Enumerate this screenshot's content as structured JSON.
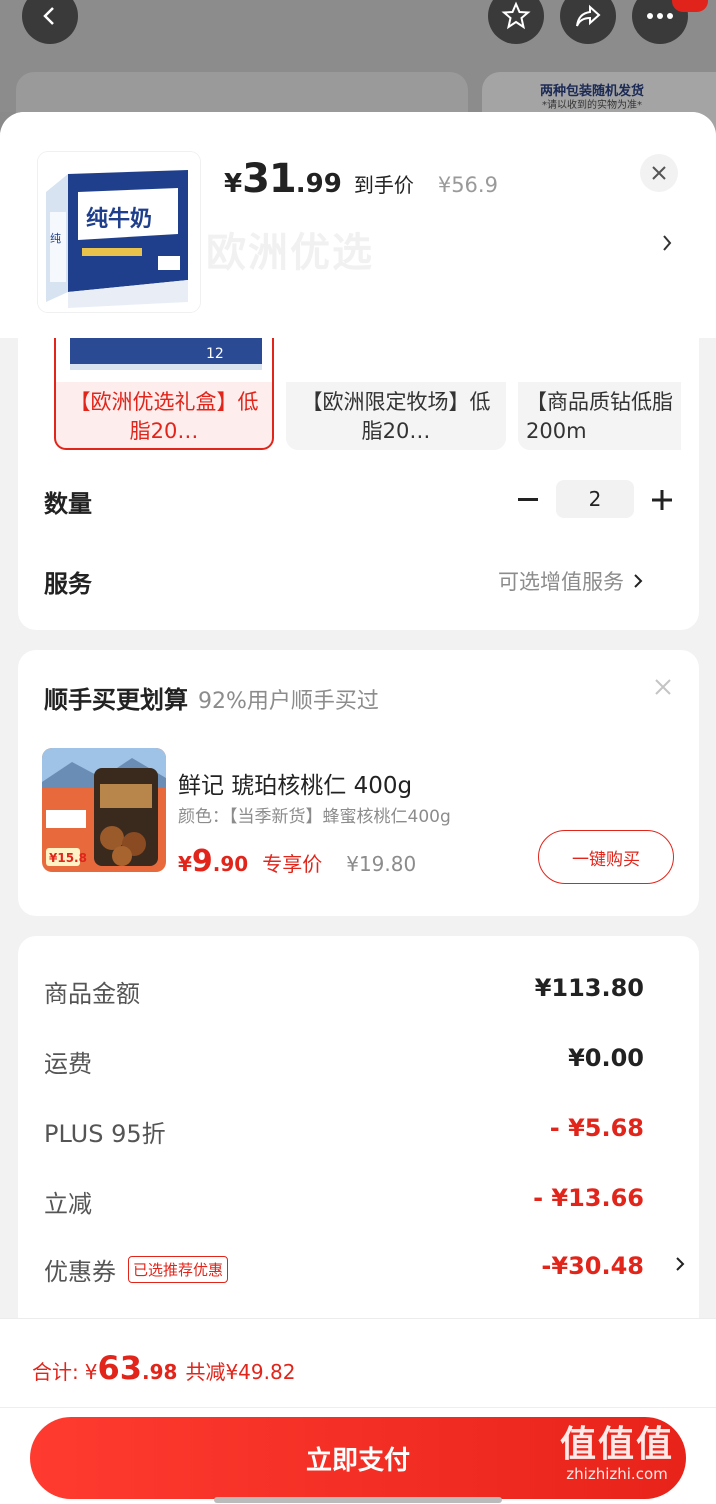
{
  "background": {
    "banner_title": "两种包装随机发货",
    "banner_sub": "*请以收到的实物为准*"
  },
  "header": {
    "price_currency": "¥",
    "price_int": "31",
    "price_dec": ".99",
    "price_tag": "到手价",
    "original_price": "¥56.9",
    "product_image": "milk-box-image",
    "watermark": "欧洲优选"
  },
  "variants": [
    {
      "label": "【欧洲优选礼盒】低脂20…",
      "selected": true
    },
    {
      "label": "【欧洲限定牧场】低脂20…",
      "selected": false
    },
    {
      "label": "【商品质钻低脂200m",
      "selected": false
    }
  ],
  "quantity": {
    "label": "数量",
    "value": "2",
    "minus": "−",
    "plus": "+"
  },
  "service": {
    "label": "服务",
    "value": "可选增值服务"
  },
  "addon": {
    "title": "顺手买更划算",
    "subtitle": "92%用户顺手买过",
    "product_name": "鲜记 琥珀核桃仁 400g",
    "product_spec": "颜色：【当季新货】蜂蜜核桃仁400g",
    "price_currency": "¥",
    "price_int": "9",
    "price_dec": ".90",
    "price_tag": "专享价",
    "original_price": "¥19.80",
    "buy_label": "一键购买",
    "image_badge_price": "¥15.8"
  },
  "summary": [
    {
      "label": "商品金额",
      "value": "¥113.80",
      "red": false
    },
    {
      "label": "运费",
      "value": "¥0.00",
      "red": false
    },
    {
      "label": "PLUS 95折",
      "value": "- ¥5.68",
      "red": true
    },
    {
      "label": "立减",
      "value": "- ¥13.66",
      "red": true
    },
    {
      "label": "优惠券",
      "value": "-¥30.48",
      "red": true,
      "tag": "已选推荐优惠"
    }
  ],
  "bottom": {
    "total_label": "合计:",
    "total_currency": "¥",
    "total_int": "63",
    "total_dec": ".98",
    "saved": "共减¥49.82",
    "pay_label": "立即支付",
    "watermark_big": "值值值",
    "watermark_small": "zhizhizhi.com"
  },
  "colors": {
    "accent": "#e1251b",
    "pay_button": "#f0302a"
  }
}
